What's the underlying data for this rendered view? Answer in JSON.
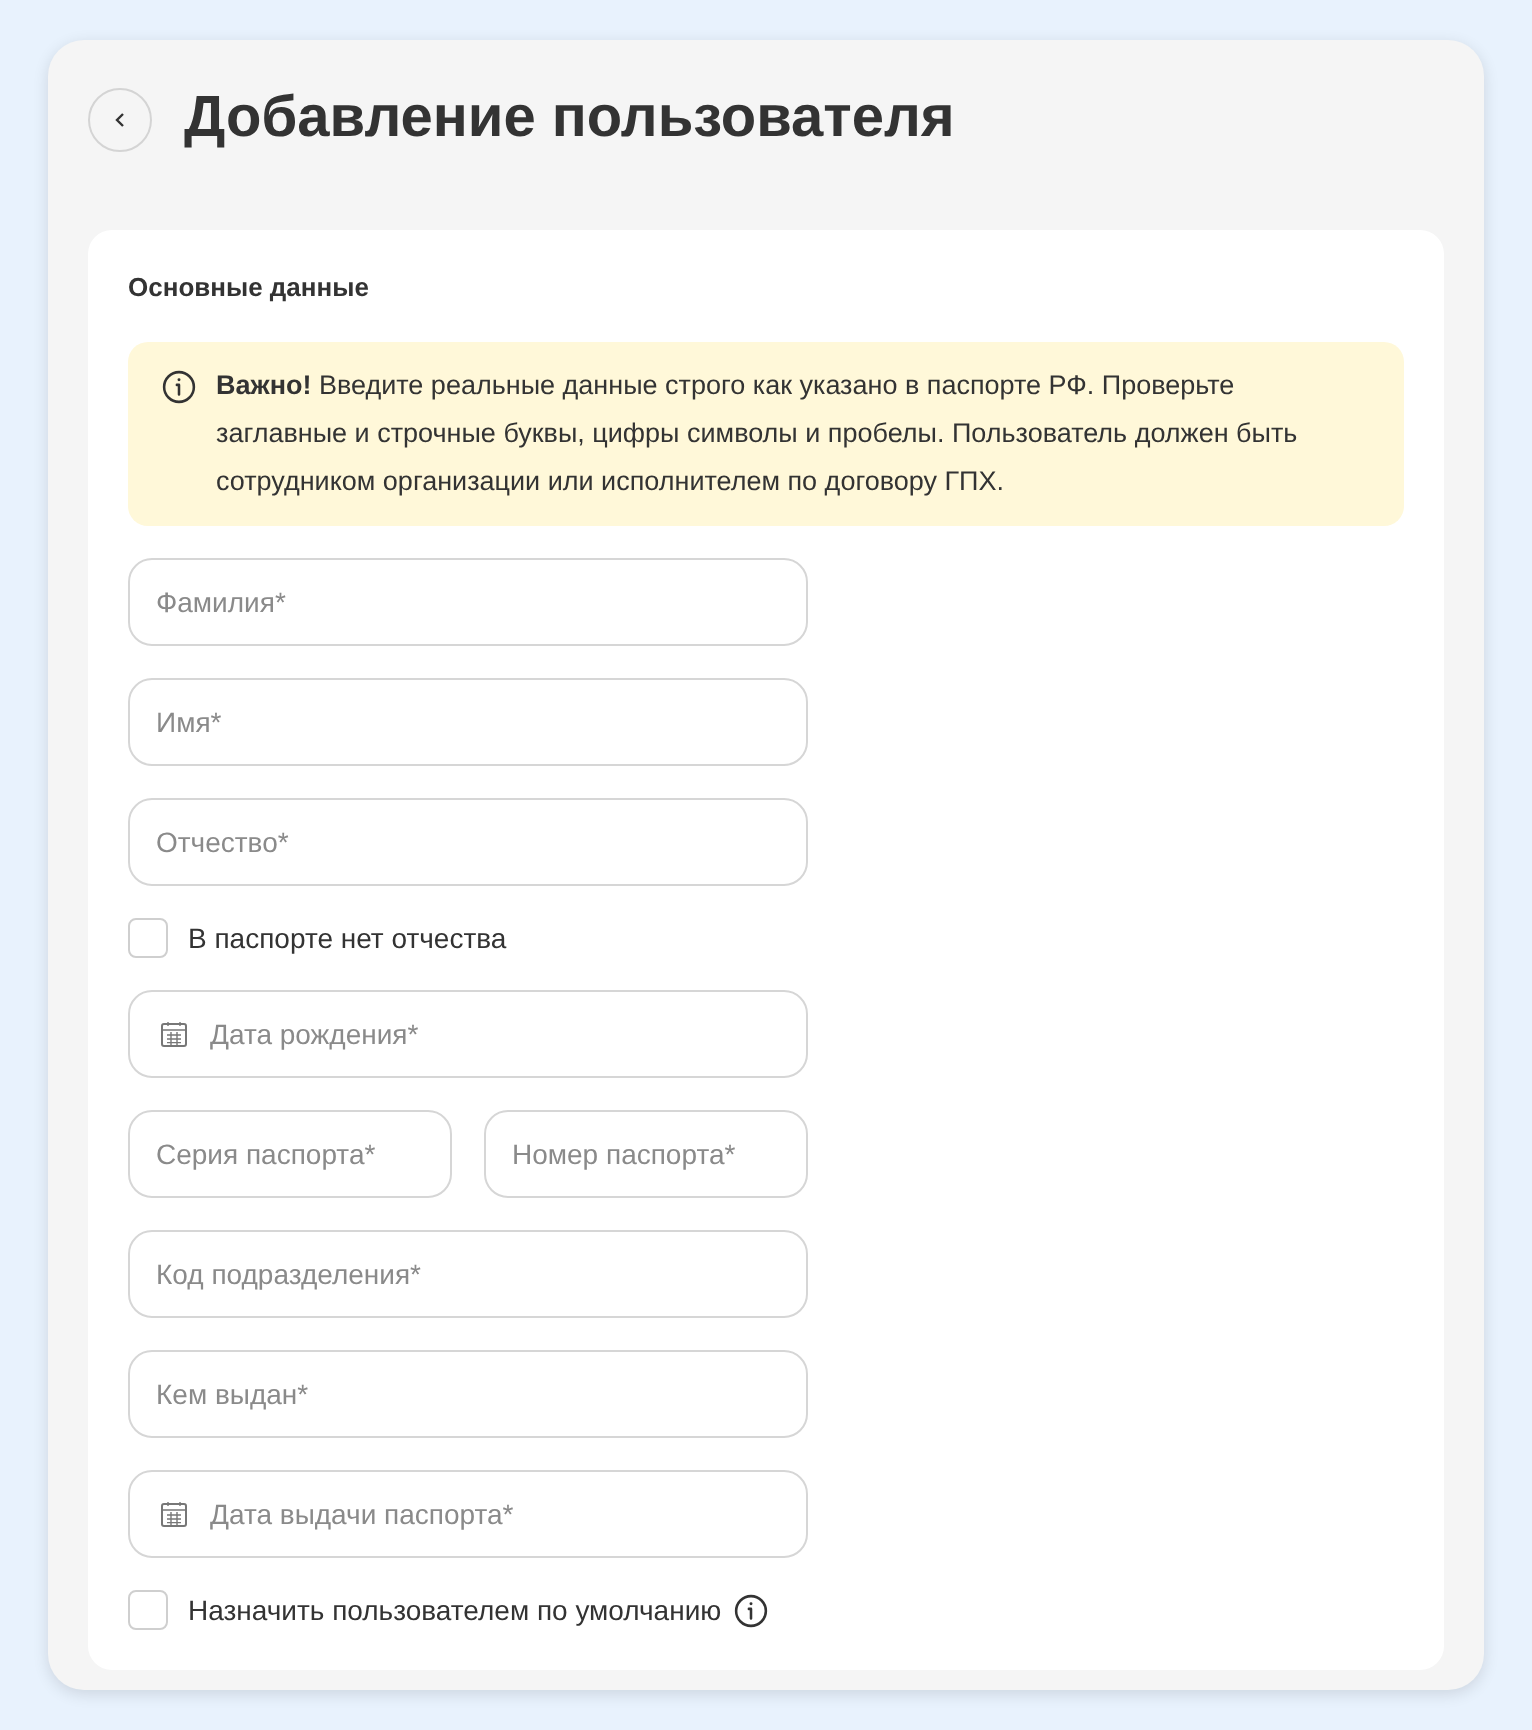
{
  "header": {
    "title": "Добавление пользователя"
  },
  "section": {
    "title": "Основные данные",
    "alert": "**Важно!** Введите реальные данные строго как указано в паспорте РФ. Проверьте заглавные и строчные буквы, цифры символы и пробелы. Пользователь должен быть сотрудником организации или исполнителем по договору ГПХ."
  },
  "form": [
    {
      "kind": "text",
      "placeholder": "Фамилия*"
    },
    {
      "kind": "text",
      "placeholder": "Имя*"
    },
    {
      "kind": "text",
      "placeholder": "Отчество*"
    },
    {
      "kind": "checkbox",
      "label": "В паспорте нет отчества",
      "checked": false,
      "info": false
    },
    {
      "kind": "date",
      "placeholder": "Дата рождения*"
    },
    {
      "kind": "pair",
      "fields": [
        {
          "placeholder": "Серия паспорта*"
        },
        {
          "placeholder": "Номер паспорта*"
        }
      ]
    },
    {
      "kind": "text",
      "placeholder": "Код подразделения*"
    },
    {
      "kind": "text",
      "placeholder": "Кем выдан*"
    },
    {
      "kind": "date",
      "placeholder": "Дата выдачи паспорта*"
    },
    {
      "kind": "checkbox",
      "label": "Назначить пользователем по умолчанию",
      "checked": false,
      "info": true
    }
  ]
}
